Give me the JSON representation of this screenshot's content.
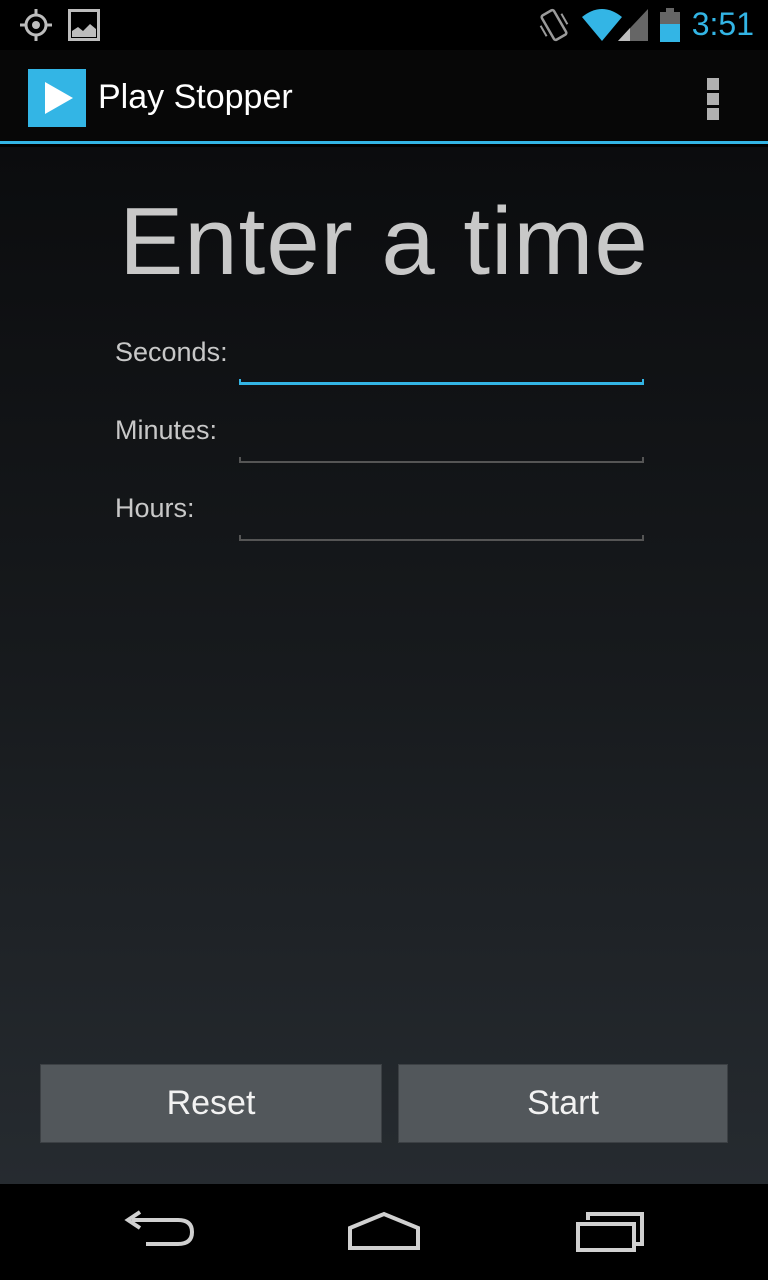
{
  "status_bar": {
    "time": "3:51",
    "icons": [
      "gps-icon",
      "picture-icon",
      "vibrate-icon",
      "wifi-icon",
      "signal-icon",
      "battery-icon"
    ],
    "clock_color": "#33b5e5"
  },
  "action_bar": {
    "title": "Play Stopper",
    "accent": "#33b5e5",
    "icons": [
      "play-icon",
      "overflow-menu-icon"
    ]
  },
  "main": {
    "headline": "Enter a time",
    "fields": [
      {
        "label": "Seconds:",
        "value": "",
        "focused": true
      },
      {
        "label": "Minutes:",
        "value": "",
        "focused": false
      },
      {
        "label": "Hours:",
        "value": "",
        "focused": false
      }
    ]
  },
  "buttons": {
    "reset": "Reset",
    "start": "Start"
  },
  "nav_bar": {
    "icons": [
      "back-icon",
      "home-icon",
      "recent-apps-icon"
    ]
  }
}
